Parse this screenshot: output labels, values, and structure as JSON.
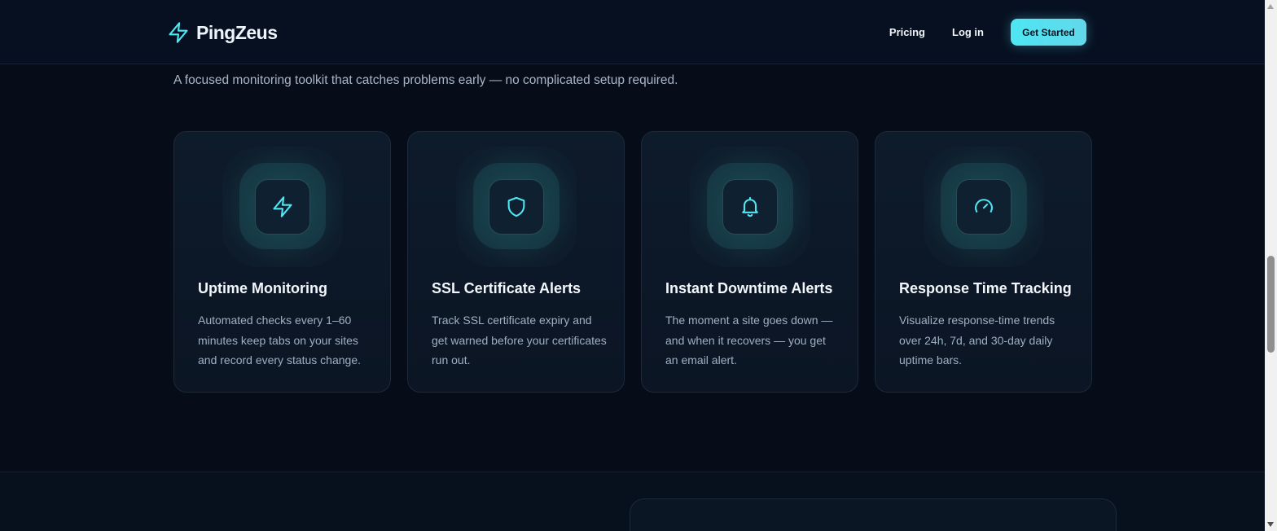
{
  "header": {
    "brand": "PingZeus",
    "nav": {
      "pricing": "Pricing",
      "login": "Log in",
      "cta": "Get Started"
    }
  },
  "section": {
    "subtitle": "A focused monitoring toolkit that catches problems early — no complicated setup required."
  },
  "features": [
    {
      "icon": "lightning-icon",
      "title": "Uptime Monitoring",
      "description": "Automated checks every 1–60 minutes keep tabs on your sites and record every status change."
    },
    {
      "icon": "shield-icon",
      "title": "SSL Certificate Alerts",
      "description": "Track SSL certificate expiry and get warned before your certificates run out."
    },
    {
      "icon": "bell-icon",
      "title": "Instant Downtime Alerts",
      "description": "The moment a site goes down — and when it recovers — you get an email alert."
    },
    {
      "icon": "gauge-icon",
      "title": "Response Time Tracking",
      "description": "Visualize response-time trends over 24h, 7d, and 30-day daily uptime bars."
    }
  ],
  "colors": {
    "accent": "#4ee6f2",
    "background": "#070d18",
    "card": "#0e1b2b"
  }
}
